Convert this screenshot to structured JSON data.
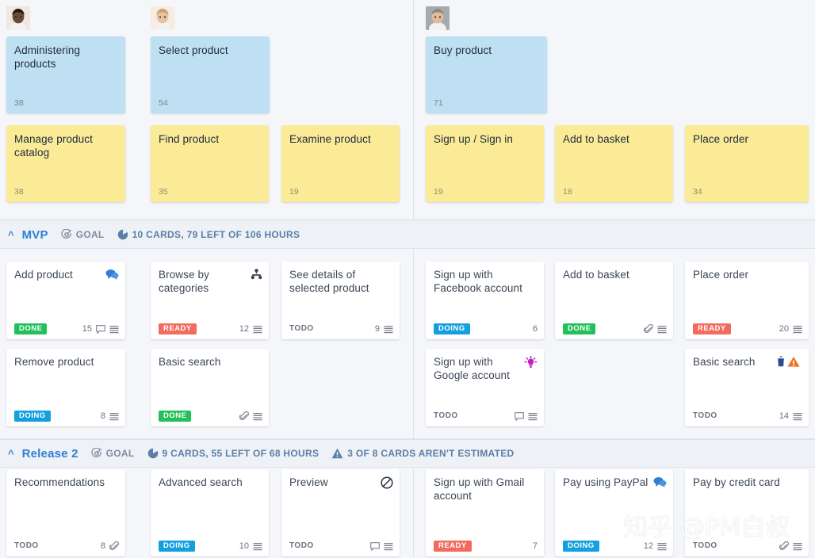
{
  "board": {
    "personas": [
      {
        "name": "persona-administrator",
        "skin": "#6b4a33",
        "hair": "#241812",
        "bg": "#efe7e0"
      },
      {
        "name": "persona-buyer-female",
        "skin": "#e9c2a2",
        "hair": "#c9a36a",
        "bg": "#f6ece2"
      },
      {
        "name": "persona-buyer-male",
        "skin": "#e3bb9a",
        "hair": "#8a8a8a",
        "bg": "#a9aaac"
      }
    ],
    "activities": [
      {
        "title": "Administering products",
        "points": "38"
      },
      {
        "title": "Select product",
        "points": "54"
      },
      {
        "title": "Buy product",
        "points": "71"
      }
    ],
    "steps": [
      {
        "title": "Manage product catalog",
        "points": "38"
      },
      {
        "title": "Find product",
        "points": "35"
      },
      {
        "title": "Examine product",
        "points": "19"
      },
      {
        "title": "Sign up / Sign in",
        "points": "19"
      },
      {
        "title": "Add to basket",
        "points": "18"
      },
      {
        "title": "Place order",
        "points": "34"
      }
    ]
  },
  "releases": [
    {
      "chevron": "^",
      "name": "MVP",
      "goal_label": "GOAL",
      "stats_label": "10 CARDS, 79 LEFT OF 106 HOURS",
      "warning_label": "",
      "cards": [
        {
          "title": "Add product",
          "status": "DONE",
          "status_color": "#22c05a",
          "status_plain": false,
          "points": "15",
          "head_icon": "chat-bubbles-icon",
          "foot_icons": [
            "comment-icon",
            "description-icon"
          ]
        },
        {
          "title": "Browse by categories",
          "status": "READY",
          "status_color": "#f26b5e",
          "status_plain": false,
          "points": "12",
          "head_icon": "branch-icon",
          "foot_icons": [
            "description-icon"
          ]
        },
        {
          "title": "See details of selected product",
          "status": "TODO",
          "status_color": "",
          "status_plain": true,
          "points": "9",
          "head_icon": "",
          "foot_icons": [
            "description-icon"
          ]
        },
        {
          "title": "Sign up with Facebook account",
          "status": "DOING",
          "status_color": "#14a0de",
          "status_plain": false,
          "points": "6",
          "head_icon": "",
          "foot_icons": []
        },
        {
          "title": "Add to basket",
          "status": "DONE",
          "status_color": "#22c05a",
          "status_plain": false,
          "points": "",
          "head_icon": "",
          "foot_icons": [
            "attachment-icon",
            "description-icon"
          ]
        },
        {
          "title": "Place order",
          "status": "READY",
          "status_color": "#f26b5e",
          "status_plain": false,
          "points": "20",
          "head_icon": "",
          "foot_icons": [
            "description-icon"
          ]
        },
        {
          "title": "Remove product",
          "status": "DOING",
          "status_color": "#14a0de",
          "status_plain": false,
          "points": "8",
          "head_icon": "",
          "foot_icons": [
            "description-icon"
          ]
        },
        {
          "title": "Basic search",
          "status": "DONE",
          "status_color": "#22c05a",
          "status_plain": false,
          "points": "",
          "head_icon": "",
          "foot_icons": [
            "attachment-icon",
            "description-icon"
          ]
        },
        {
          "title": "Sign up with Google account",
          "status": "TODO",
          "status_color": "",
          "status_plain": true,
          "points": "",
          "head_icon": "lightbulb-icon",
          "foot_icons": [
            "comment-icon",
            "description-icon"
          ]
        },
        {
          "title": "Basic search",
          "status": "TODO",
          "status_color": "",
          "status_plain": true,
          "points": "14",
          "head_icon": "trash-warning-icon",
          "foot_icons": [
            "description-icon"
          ]
        }
      ]
    },
    {
      "chevron": "^",
      "name": "Release 2",
      "goal_label": "GOAL",
      "stats_label": "9 CARDS, 55 LEFT OF 68 HOURS",
      "warning_label": "3 OF 8 CARDS AREN'T ESTIMATED",
      "cards": [
        {
          "title": "Recommendations",
          "status": "TODO",
          "status_color": "",
          "status_plain": true,
          "points": "8",
          "head_icon": "",
          "foot_icons": [
            "attachment-icon"
          ]
        },
        {
          "title": "Advanced search",
          "status": "DOING",
          "status_color": "#14a0de",
          "status_plain": false,
          "points": "10",
          "head_icon": "",
          "foot_icons": [
            "description-icon"
          ]
        },
        {
          "title": "Preview",
          "status": "TODO",
          "status_color": "",
          "status_plain": true,
          "points": "",
          "head_icon": "blocked-icon",
          "foot_icons": [
            "comment-icon",
            "description-icon"
          ]
        },
        {
          "title": "Sign up with Gmail account",
          "status": "READY",
          "status_color": "#f26b5e",
          "status_plain": false,
          "points": "7",
          "head_icon": "",
          "foot_icons": []
        },
        {
          "title": "Pay using PayPal",
          "status": "DOING",
          "status_color": "#14a0de",
          "status_plain": false,
          "points": "12",
          "head_icon": "chat-bubbles-icon",
          "foot_icons": [
            "description-icon"
          ]
        },
        {
          "title": "Pay by credit card",
          "status": "TODO",
          "status_color": "",
          "status_plain": true,
          "points": "",
          "head_icon": "",
          "foot_icons": [
            "attachment-icon",
            "description-icon"
          ]
        }
      ]
    }
  ],
  "watermark": {
    "text": "知乎 @PM白叔"
  }
}
